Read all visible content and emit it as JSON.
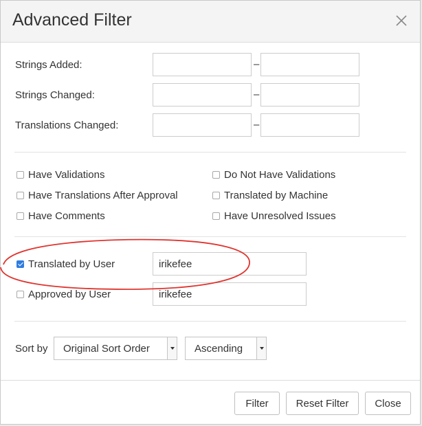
{
  "dialog": {
    "title": "Advanced Filter"
  },
  "ranges": [
    {
      "label": "Strings Added:",
      "from": "",
      "to": "",
      "dash": "–"
    },
    {
      "label": "Strings Changed:",
      "from": "",
      "to": "",
      "dash": "–"
    },
    {
      "label": "Translations Changed:",
      "from": "",
      "to": "",
      "dash": "–"
    }
  ],
  "checkboxes": {
    "have_validations": {
      "label": "Have Validations",
      "checked": false
    },
    "do_not_have_validations": {
      "label": "Do Not Have Validations",
      "checked": false
    },
    "have_translations_after_approval": {
      "label": "Have Translations After Approval",
      "checked": false
    },
    "translated_by_machine": {
      "label": "Translated by Machine",
      "checked": false
    },
    "have_comments": {
      "label": "Have Comments",
      "checked": false
    },
    "have_unresolved_issues": {
      "label": "Have Unresolved Issues",
      "checked": false
    }
  },
  "user_filters": {
    "translated_by_user": {
      "label": "Translated by User",
      "checked": true,
      "value": "irikefee"
    },
    "approved_by_user": {
      "label": "Approved by User",
      "checked": false,
      "value": "irikefee"
    }
  },
  "sort": {
    "label": "Sort by",
    "order_value": "Original Sort Order",
    "direction_value": "Ascending"
  },
  "buttons": {
    "filter": "Filter",
    "reset_filter": "Reset Filter",
    "close": "Close"
  },
  "colors": {
    "checkbox_checked": "#2f7de1",
    "annotation_ellipse": "#e0342f"
  },
  "icons": {
    "close": "close-icon"
  }
}
